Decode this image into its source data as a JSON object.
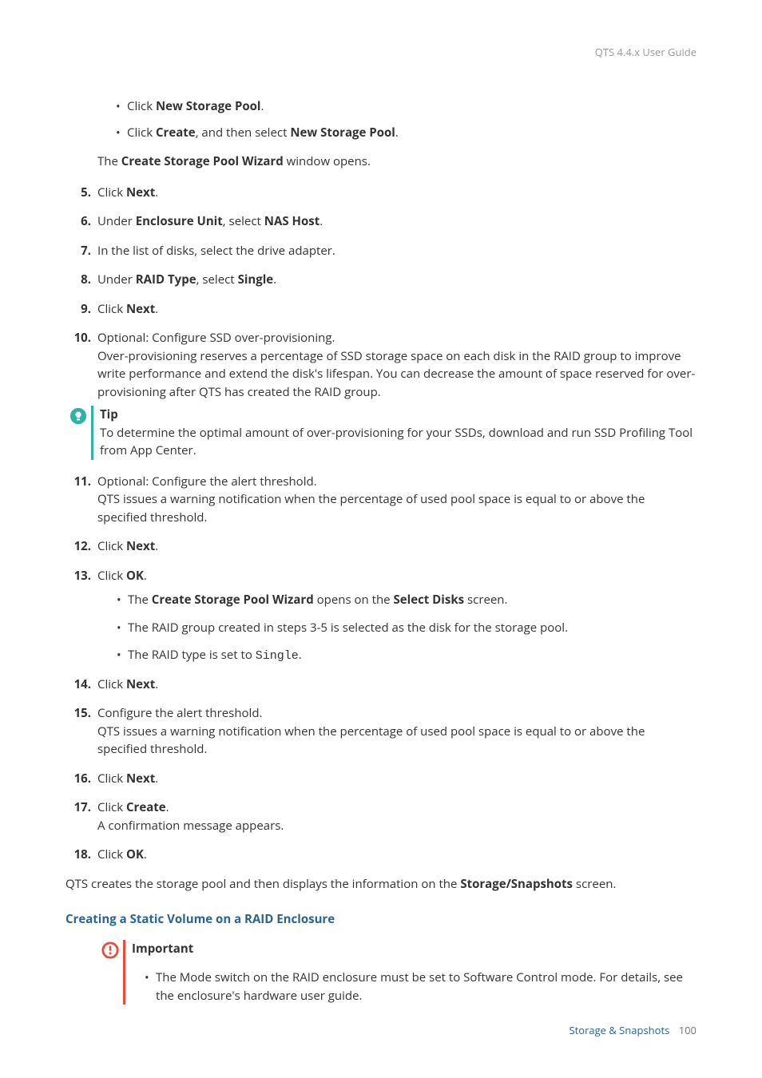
{
  "header": {
    "guide_title": "QTS 4.4.x User Guide"
  },
  "intro_bullets": [
    {
      "prefix": "Click ",
      "bold": "New Storage Pool",
      "suffix": "."
    },
    {
      "prefix": "Click ",
      "bold": "Create",
      "middle": ", and then select ",
      "bold2": "New Storage Pool",
      "suffix": "."
    }
  ],
  "intro_para": {
    "pre": "The ",
    "bold": "Create Storage Pool Wizard",
    "post": " window opens."
  },
  "steps": {
    "s5": {
      "num": "5.",
      "pre": "Click ",
      "b1": "Next",
      "post": "."
    },
    "s6": {
      "num": "6.",
      "pre": "Under ",
      "b1": "Enclosure Unit",
      "mid": ", select ",
      "b2": "NAS Host",
      "post": "."
    },
    "s7": {
      "num": "7.",
      "text": "In the list of disks, select the drive adapter."
    },
    "s8": {
      "num": "8.",
      "pre": "Under ",
      "b1": "RAID Type",
      "mid": ", select ",
      "b2": "Single",
      "post": "."
    },
    "s9": {
      "num": "9.",
      "pre": "Click ",
      "b1": "Next",
      "post": "."
    },
    "s10": {
      "num": "10.",
      "line1": "Optional: Configure SSD over-provisioning.",
      "line2": "Over-provisioning reserves a percentage of SSD storage space on each disk in the RAID group to improve write performance and extend the disk's lifespan. You can decrease the amount of space reserved for over-provisioning after QTS has created the RAID group."
    },
    "tip": {
      "title": "Tip",
      "body": "To determine the optimal amount of over-provisioning for your SSDs, download and run SSD Profiling Tool from App Center."
    },
    "s11": {
      "num": "11.",
      "line1": "Optional: Configure the alert threshold.",
      "line2": "QTS issues a warning notification when the percentage of used pool space is equal to or above the specified threshold."
    },
    "s12": {
      "num": "12.",
      "pre": "Click ",
      "b1": "Next",
      "post": "."
    },
    "s13": {
      "num": "13.",
      "pre": "Click ",
      "b1": "OK",
      "post": ".",
      "sub1": {
        "pre": "The ",
        "b1": "Create Storage Pool Wizard",
        "mid": " opens on the ",
        "b2": "Select Disks",
        "post": " screen."
      },
      "sub2": "The RAID group created in steps 3-5 is selected as the disk for the storage pool.",
      "sub3": {
        "pre": "The RAID type is set to ",
        "code": "Single",
        "post": "."
      }
    },
    "s14": {
      "num": "14.",
      "pre": "Click ",
      "b1": "Next",
      "post": "."
    },
    "s15": {
      "num": "15.",
      "line1": "Configure the alert threshold.",
      "line2": "QTS issues a warning notification when the percentage of used pool space is equal to or above the specified threshold."
    },
    "s16": {
      "num": "16.",
      "pre": "Click ",
      "b1": "Next",
      "post": "."
    },
    "s17": {
      "num": "17.",
      "pre": "Click ",
      "b1": "Create",
      "post": ".",
      "line2": "A confirmation message appears."
    },
    "s18": {
      "num": "18.",
      "pre": "Click ",
      "b1": "OK",
      "post": "."
    }
  },
  "closing": {
    "pre": "QTS creates the storage pool and then displays the information on the ",
    "b1": "Storage/Snapshots",
    "post": " screen."
  },
  "section_heading": "Creating a Static Volume on a RAID Enclosure",
  "important": {
    "title": "Important",
    "body": "The Mode switch on the RAID enclosure must be set to Software Control mode. For details, see the enclosure's hardware user guide."
  },
  "footer": {
    "section": "Storage & Snapshots",
    "page": "100"
  }
}
